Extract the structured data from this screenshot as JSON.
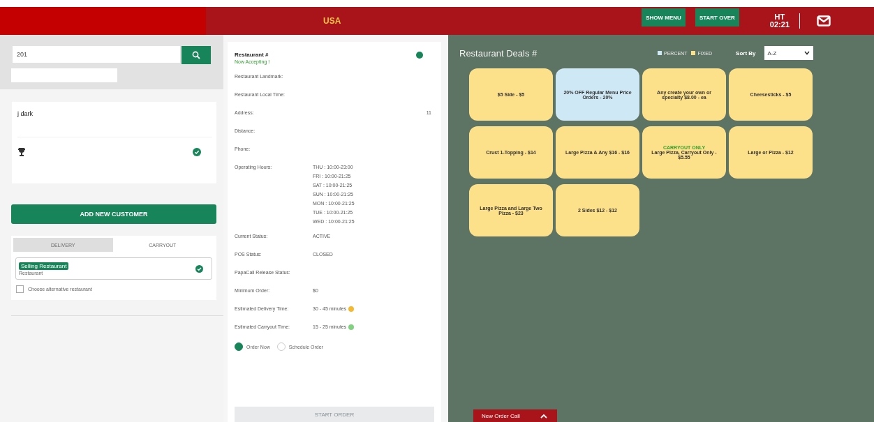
{
  "header": {
    "title": "USA",
    "buttons": [
      "SHOW MENU",
      "START OVER"
    ],
    "time_label": "HT",
    "time": "02:21"
  },
  "search": {
    "value": "201"
  },
  "customer": {
    "name": "j dark",
    "verified": true
  },
  "add_customer_button": "ADD NEW CUSTOMER",
  "order_tabs": [
    {
      "label": "DELIVERY",
      "selected": true
    },
    {
      "label": "CARRYOUT",
      "selected": false
    }
  ],
  "restaurant_select": {
    "badge": "Selling Restaurant",
    "value": "Restaurant",
    "verified": true
  },
  "alternative": {
    "label": "Choose alternative restaurant",
    "checked": false
  },
  "restaurant": {
    "name": "Restaurant #",
    "status": "Now Accepting !",
    "open": true,
    "details": [
      {
        "label": "Restaurant Landmark:"
      },
      {
        "label": "Restaurant Local Time:"
      },
      {
        "label": "Address:",
        "value": "11",
        "right_aligned": true
      },
      {
        "label": "Distance:"
      },
      {
        "label": "Phone:"
      },
      {
        "label": "Operating Hours:",
        "lines": [
          "THU : 10:00-23:00",
          "FRI : 10:00-21:25",
          "SAT : 10:00-21:25",
          "SUN : 10:00-21:25",
          "MON : 10:00-21:25",
          "TUE : 10:00-21:25",
          "WED : 10:00-21:25"
        ]
      },
      {
        "label": "Current Status:",
        "value": "ACTIVE"
      },
      {
        "label": "POS Status:",
        "value": "CLOSED"
      },
      {
        "label": "PapaCall Release Status:"
      },
      {
        "label": "Minimum Order:",
        "value": "$0"
      },
      {
        "label": "Estimated Delivery Time:",
        "value": "30 - 45 minutes",
        "color": "#f5b82e"
      },
      {
        "label": "Estimated Carryout Time:",
        "value": "15 - 25 minutes",
        "color": "#7fd37f"
      }
    ],
    "timing": [
      {
        "label": "Order Now",
        "selected": true
      },
      {
        "label": "Schedule Order",
        "selected": false
      }
    ],
    "start_button": {
      "label": "START ORDER",
      "disabled": true
    }
  },
  "deals": {
    "title": "Restaurant Deals #",
    "legend": [
      {
        "label": "PERCENT",
        "color": "#cfe8f5"
      },
      {
        "label": "FIXED",
        "color": "#fde08a"
      }
    ],
    "sort_label": "Sort By",
    "sort_value": "A-Z",
    "items": [
      {
        "kind": "fixed",
        "text": "$5 Side - $5"
      },
      {
        "kind": "percent",
        "text": "20% OFF Regular Menu Price Orders - 20%"
      },
      {
        "kind": "fixed",
        "text": "Any create your own or specialty $8.00 - ea"
      },
      {
        "kind": "fixed",
        "text": "Cheesesticks - $5"
      },
      {
        "kind": "fixed",
        "text": "Crust 1-Topping - $14"
      },
      {
        "kind": "fixed",
        "text": "Large Pizza & Any $16 - $16"
      },
      {
        "kind": "fixed",
        "note": "CARRYOUT ONLY",
        "text": "Large Pizza, Carryout Only - $5.55"
      },
      {
        "kind": "fixed",
        "text": "Large or Pizza - $12"
      },
      {
        "kind": "fixed",
        "text": "Large Pizza and Large Two Pizza - $23"
      },
      {
        "kind": "fixed",
        "text": "2 Sides $12 - $12"
      }
    ]
  },
  "new_order_call": "New Order Call"
}
